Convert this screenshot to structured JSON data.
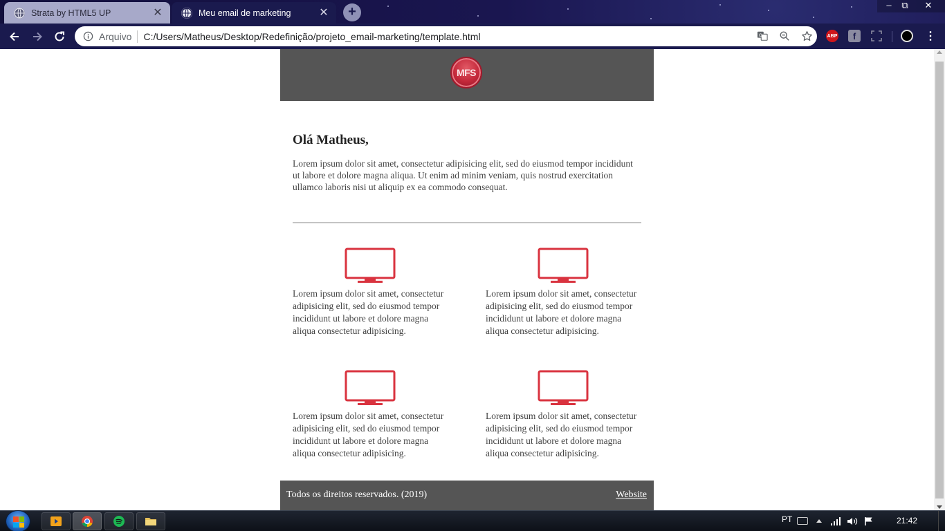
{
  "browser": {
    "tabs": [
      {
        "title": "Strata by HTML5 UP",
        "active": false
      },
      {
        "title": "Meu email de marketing",
        "active": true
      }
    ],
    "window_controls": {
      "minimize": "–",
      "maximize": "⧉",
      "close": "✕"
    },
    "address_bar": {
      "scheme_label": "Arquivo",
      "url": "C:/Users/Matheus/Desktop/Redefinição/projeto_email-marketing/template.html"
    },
    "extensions": {
      "adblock_label": "ABP",
      "facebook_label": "f",
      "menu_label": "⋮"
    }
  },
  "email": {
    "logo_text": "MFS",
    "greeting": "Olá Matheus,",
    "intro": "Lorem ipsum dolor sit amet, consectetur adipisicing elit, sed do eiusmod tempor incididunt ut labore et dolore magna aliqua. Ut enim ad minim veniam, quis nostrud exercitation ullamco laboris nisi ut aliquip ex ea commodo consequat.",
    "features": [
      {
        "icon": "monitor-icon",
        "text": "Lorem ipsum dolor sit amet, consectetur adipisicing elit, sed do eiusmod tempor incididunt ut labore et dolore magna aliqua consectetur adipisicing."
      },
      {
        "icon": "monitor-icon",
        "text": "Lorem ipsum dolor sit amet, consectetur adipisicing elit, sed do eiusmod tempor incididunt ut labore et dolore magna aliqua consectetur adipisicing."
      },
      {
        "icon": "monitor-icon",
        "text": "Lorem ipsum dolor sit amet, consectetur adipisicing elit, sed do eiusmod tempor incididunt ut labore et dolore magna aliqua consectetur adipisicing."
      },
      {
        "icon": "monitor-icon",
        "text": "Lorem ipsum dolor sit amet, consectetur adipisicing elit, sed do eiusmod tempor incididunt ut labore et dolore magna aliqua consectetur adipisicing."
      }
    ],
    "footer": {
      "copyright": "Todos os direitos reservados. (2019)",
      "website_link": "Website"
    },
    "colors": {
      "header_bg": "#555555",
      "accent_red": "#d9333f"
    }
  },
  "taskbar": {
    "language": "PT",
    "time": "21:42"
  }
}
